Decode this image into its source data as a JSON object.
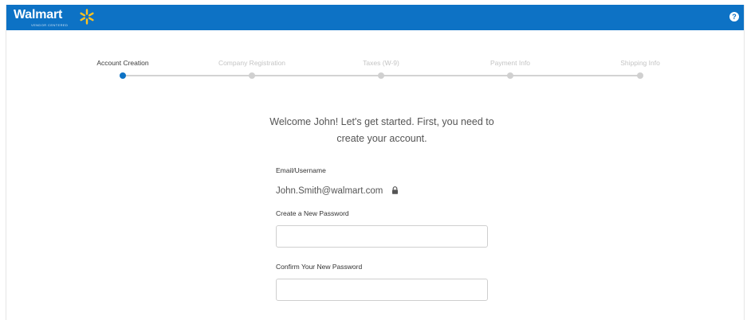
{
  "header": {
    "brand": "Walmart",
    "brand_sub": "VENDOR CENTERED",
    "help_icon": "question-circle-icon",
    "brand_color": "#0d72c5",
    "spark_color": "#ffc220"
  },
  "stepper": {
    "steps": [
      {
        "label": "Account Creation",
        "active": true
      },
      {
        "label": "Company Registration",
        "active": false
      },
      {
        "label": "Taxes (W-9)",
        "active": false
      },
      {
        "label": "Payment Info",
        "active": false
      },
      {
        "label": "Shipping Info",
        "active": false
      }
    ]
  },
  "welcome": {
    "line1": "Welcome John! Let's get started. First, you need to",
    "line2": "create your account."
  },
  "form": {
    "email_label": "Email/Username",
    "email_value": "John.Smith@walmart.com",
    "lock_icon": "lock-icon",
    "password_label": "Create a New Password",
    "password_value": "",
    "confirm_label": "Confirm Your New Password",
    "confirm_value": ""
  }
}
